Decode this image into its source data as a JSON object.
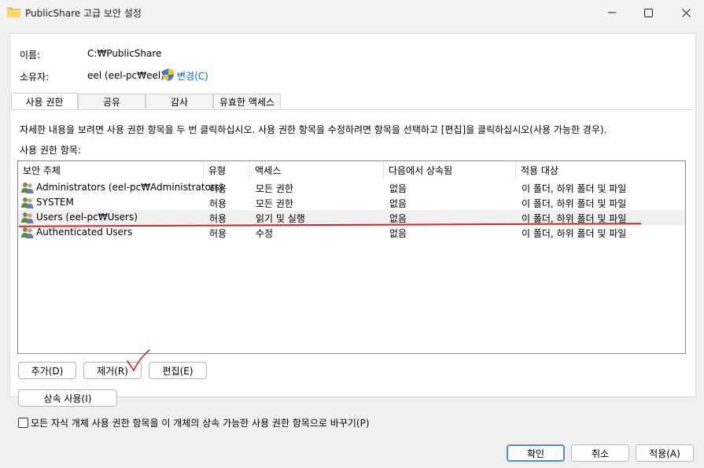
{
  "window": {
    "title": "PublicShare 고급 보안 설정",
    "minimize_label": "—",
    "maximize_label": "☐",
    "close_label": "✕"
  },
  "info": {
    "name_label": "이름:",
    "name_value": "C:₩PublicShare",
    "owner_label": "소유자:",
    "owner_value": "eel (eel-pc₩eel)",
    "change_link": "변경(C)"
  },
  "tabs": [
    "사용 권한",
    "공유",
    "감사",
    "유효한 액세스"
  ],
  "description": "자세한 내용을 보려면 사용 권한 항목을 두 번 클릭하십시오. 사용 권한 항목을 수정하려면 항목을 선택하고 [편집]을 클릭하십시오(사용 가능한 경우).",
  "entries_label": "사용 권한 항목:",
  "table": {
    "columns": [
      "보안 주체",
      "유형",
      "액세스",
      "다음에서 상속됨",
      "적용 대상"
    ],
    "rows": [
      [
        "Administrators (eel-pc₩Administrators)",
        "허용",
        "모든 권한",
        "없음",
        "이 폴더, 하위 폴더 및 파일"
      ],
      [
        "SYSTEM",
        "허용",
        "모든 권한",
        "없음",
        "이 폴더, 하위 폴더 및 파일"
      ],
      [
        "Users (eel-pc₩Users)",
        "허용",
        "읽기 및 실행",
        "없음",
        "이 폴더, 하위 폴더 및 파일"
      ],
      [
        "Authenticated Users",
        "허용",
        "수정",
        "없음",
        "이 폴더, 하위 폴더 및 파일"
      ]
    ]
  },
  "buttons": {
    "add": "추가(D)",
    "remove": "제거(R)",
    "edit": "편집(E)",
    "inherit": "상속 사용(I)",
    "ok": "확인",
    "cancel": "취소",
    "apply": "적용(A)"
  },
  "replace_checkbox_label": "모든 자식 개체 사용 권한 항목을 이 개체의 상속 가능한 사용 권한 항목으로 바꾸기(P)",
  "colors": {
    "annotation_red": "#e02020",
    "accent_blue": "#0066cc",
    "selected_row": "#f0f0f0"
  }
}
